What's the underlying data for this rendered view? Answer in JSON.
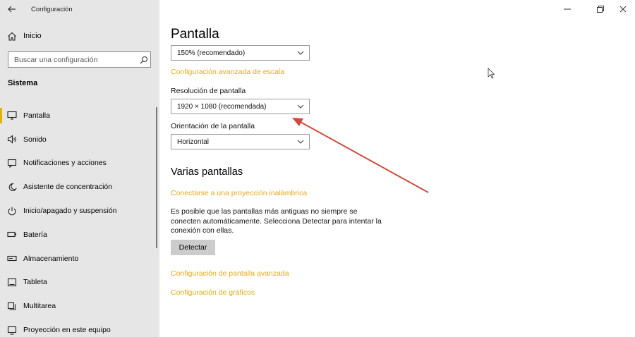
{
  "window": {
    "app_title": "Configuración",
    "back_icon": "back-arrow-icon",
    "controls": [
      "minimize-icon",
      "restore-icon",
      "close-icon"
    ]
  },
  "sidebar": {
    "home_label": "Inicio",
    "search_placeholder": "Buscar una configuración",
    "group_title": "Sistema",
    "items": [
      {
        "label": "Pantalla",
        "icon": "monitor-icon",
        "active": true
      },
      {
        "label": "Sonido",
        "icon": "speaker-icon"
      },
      {
        "label": "Notificaciones y acciones",
        "icon": "notification-icon"
      },
      {
        "label": "Asistente de concentración",
        "icon": "moon-icon"
      },
      {
        "label": "Inicio/apagado y suspensión",
        "icon": "power-icon"
      },
      {
        "label": "Batería",
        "icon": "battery-icon"
      },
      {
        "label": "Almacenamiento",
        "icon": "storage-icon"
      },
      {
        "label": "Tableta",
        "icon": "tablet-icon"
      },
      {
        "label": "Multitarea",
        "icon": "multitask-icon"
      },
      {
        "label": "Proyección en este equipo",
        "icon": "projection-icon"
      }
    ]
  },
  "main": {
    "title": "Pantalla",
    "scale_value": "150% (recomendado)",
    "advanced_scale_link": "Configuración avanzada de escala",
    "resolution_label": "Resolución de pantalla",
    "resolution_value": "1920 × 1080 (recomendada)",
    "orientation_label": "Orientación de la pantalla",
    "orientation_value": "Horizontal",
    "multiple_title": "Varias pantallas",
    "wireless_link": "Conectarse a una proyección inalámbrica",
    "detect_text": "Es posible que las pantallas más antiguas no siempre se conecten automáticamente. Selecciona Detectar para intentar la conexión con ellas.",
    "detect_button": "Detectar",
    "advanced_display_link": "Configuración de pantalla avanzada",
    "graphics_link": "Configuración de gráficos"
  },
  "colors": {
    "sidebar_bg": "#e6e6e6",
    "accent_link": "#e6a817",
    "active_indicator": "#e6b000",
    "annotation_arrow": "#d04a3c"
  }
}
